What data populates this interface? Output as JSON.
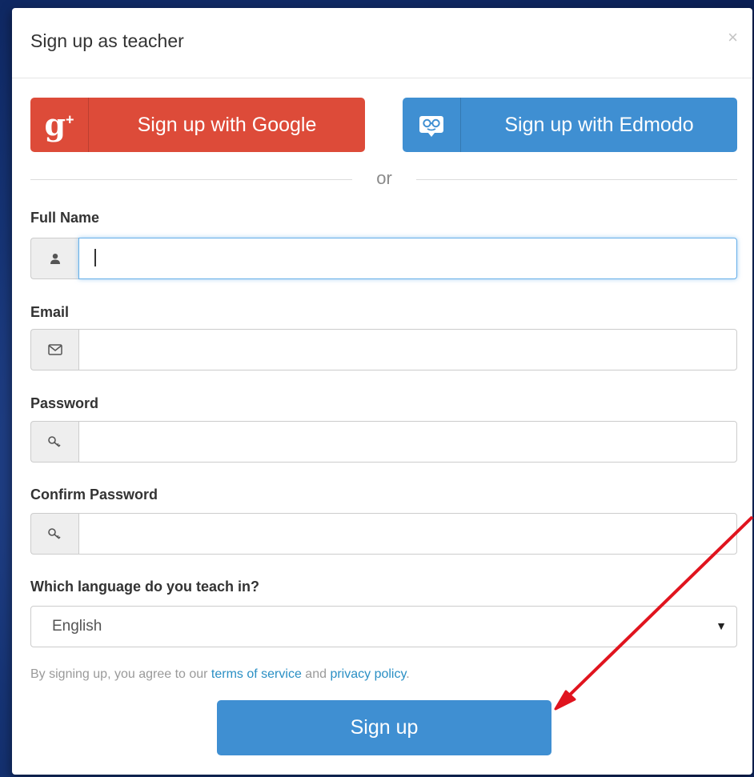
{
  "modal": {
    "title": "Sign up as teacher",
    "close_symbol": "×"
  },
  "oauth": {
    "google": {
      "label": "Sign up with Google",
      "icon": "google-plus-icon",
      "icon_glyph": "g",
      "icon_sup": "+",
      "color": "#dd4b39"
    },
    "edmodo": {
      "label": "Sign up with Edmodo",
      "icon": "edmodo-owl-icon",
      "color": "#3f8fd2"
    }
  },
  "divider_text": "or",
  "fields": {
    "full_name": {
      "label": "Full Name",
      "icon": "user-icon",
      "value": ""
    },
    "email": {
      "label": "Email",
      "icon": "envelope-icon",
      "value": ""
    },
    "password": {
      "label": "Password",
      "icon": "key-icon",
      "value": ""
    },
    "confirm_password": {
      "label": "Confirm Password",
      "icon": "key-icon",
      "value": ""
    }
  },
  "language": {
    "label": "Which language do you teach in?",
    "selected": "English"
  },
  "terms": {
    "prefix": "By signing up, you agree to our ",
    "tos_link": "terms of service",
    "middle": " and ",
    "privacy_link": "privacy policy",
    "suffix": "."
  },
  "submit_label": "Sign up",
  "colors": {
    "accent": "#3f8fd2",
    "google": "#dd4b39",
    "link": "#2a8fc4",
    "annotation_arrow": "#e0141e"
  }
}
